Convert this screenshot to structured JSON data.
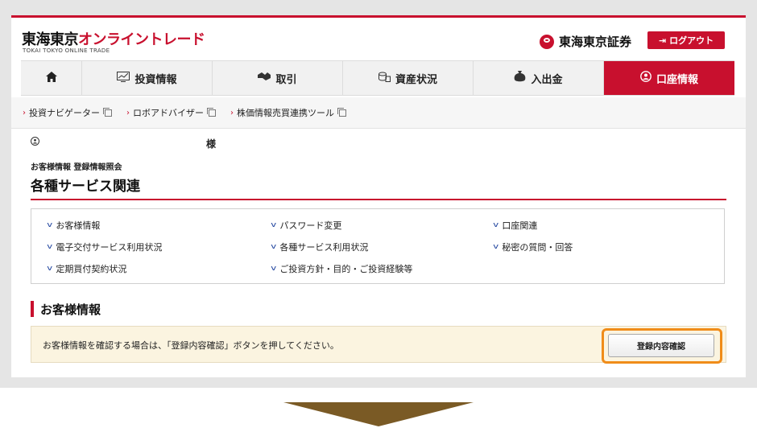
{
  "header": {
    "logo_dark": "東海東京",
    "logo_red": "オンライントレード",
    "logo_sub": "TOKAI TOKYO ONLINE TRADE",
    "brand": "東海東京証券",
    "logout": "ログアウト"
  },
  "nav": {
    "items": [
      {
        "label": "投資情報",
        "icon": "chart-icon"
      },
      {
        "label": "取引",
        "icon": "handshake-icon"
      },
      {
        "label": "資産状況",
        "icon": "coins-icon"
      },
      {
        "label": "入出金",
        "icon": "money-bag-icon"
      },
      {
        "label": "口座情報",
        "icon": "user-circle-icon"
      }
    ]
  },
  "subnav": {
    "items": [
      {
        "label": "投資ナビゲーター"
      },
      {
        "label": "ロボアドバイザー"
      },
      {
        "label": "株価情報売買連携ツール"
      }
    ]
  },
  "user": {
    "sama": "様"
  },
  "breadcrumb": "お客様情報 登録情報照会",
  "page_title": "各種サービス関連",
  "links": [
    "お客様情報",
    "パスワード変更",
    "口座関連",
    "電子交付サービス利用状況",
    "各種サービス利用状況",
    "秘密の質問・回答",
    "定期買付契約状況",
    "ご投資方針・目的・ご投資経験等"
  ],
  "section": {
    "title": "お客様情報",
    "info": "お客様情報を確認する場合は、「登録内容確認」ボタンを押してください。",
    "button": "登録内容確認"
  },
  "colors": {
    "brand_red": "#c8102e",
    "highlight_orange": "#f08c19",
    "info_bg": "#fbf4e0",
    "arrow": "#7a5a25"
  }
}
